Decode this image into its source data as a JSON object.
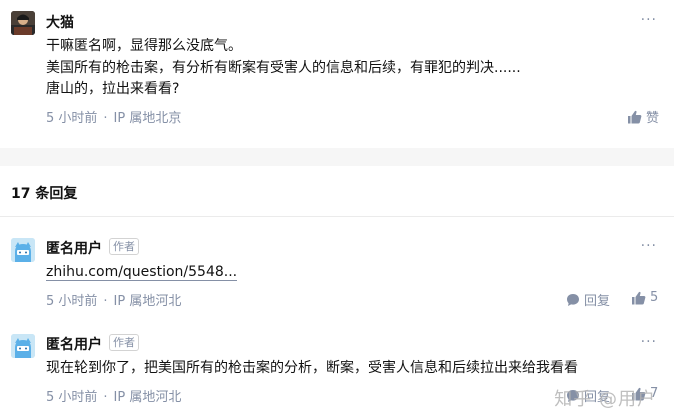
{
  "root_comment": {
    "author": "大猫",
    "lines": [
      "干嘛匿名啊，显得那么没底气。",
      "美国所有的枪击案，有分析有断案有受害人的信息和后续，有罪犯的判决......",
      "唐山的，拉出来看看?"
    ],
    "time": "5 小时前",
    "location": "IP 属地北京",
    "like_label": "赞",
    "more": "···"
  },
  "replies_header": {
    "count_label": "17 条回复"
  },
  "replies": [
    {
      "author": "匿名用户",
      "badge": "作者",
      "link_text": "zhihu.com/question/5548...",
      "time": "5 小时前",
      "location": "IP 属地河北",
      "reply_label": "回复",
      "like_count": "5",
      "more": "···"
    },
    {
      "author": "匿名用户",
      "badge": "作者",
      "text": "现在轮到你了，把美国所有的枪击案的分析，断案，受害人信息和后续拉出来给我看看",
      "time": "5 小时前",
      "location": "IP 属地河北",
      "reply_label": "回复",
      "like_count": "7",
      "more": "···"
    }
  ],
  "watermark": "知乎 @用户",
  "colors": {
    "meta": "#8590a6",
    "text": "#121212",
    "divider": "#ebebeb",
    "gap": "#f6f6f6"
  },
  "icons": {
    "like": "thumbs-up-icon",
    "reply": "speech-bubble-icon",
    "more": "more-icon"
  }
}
